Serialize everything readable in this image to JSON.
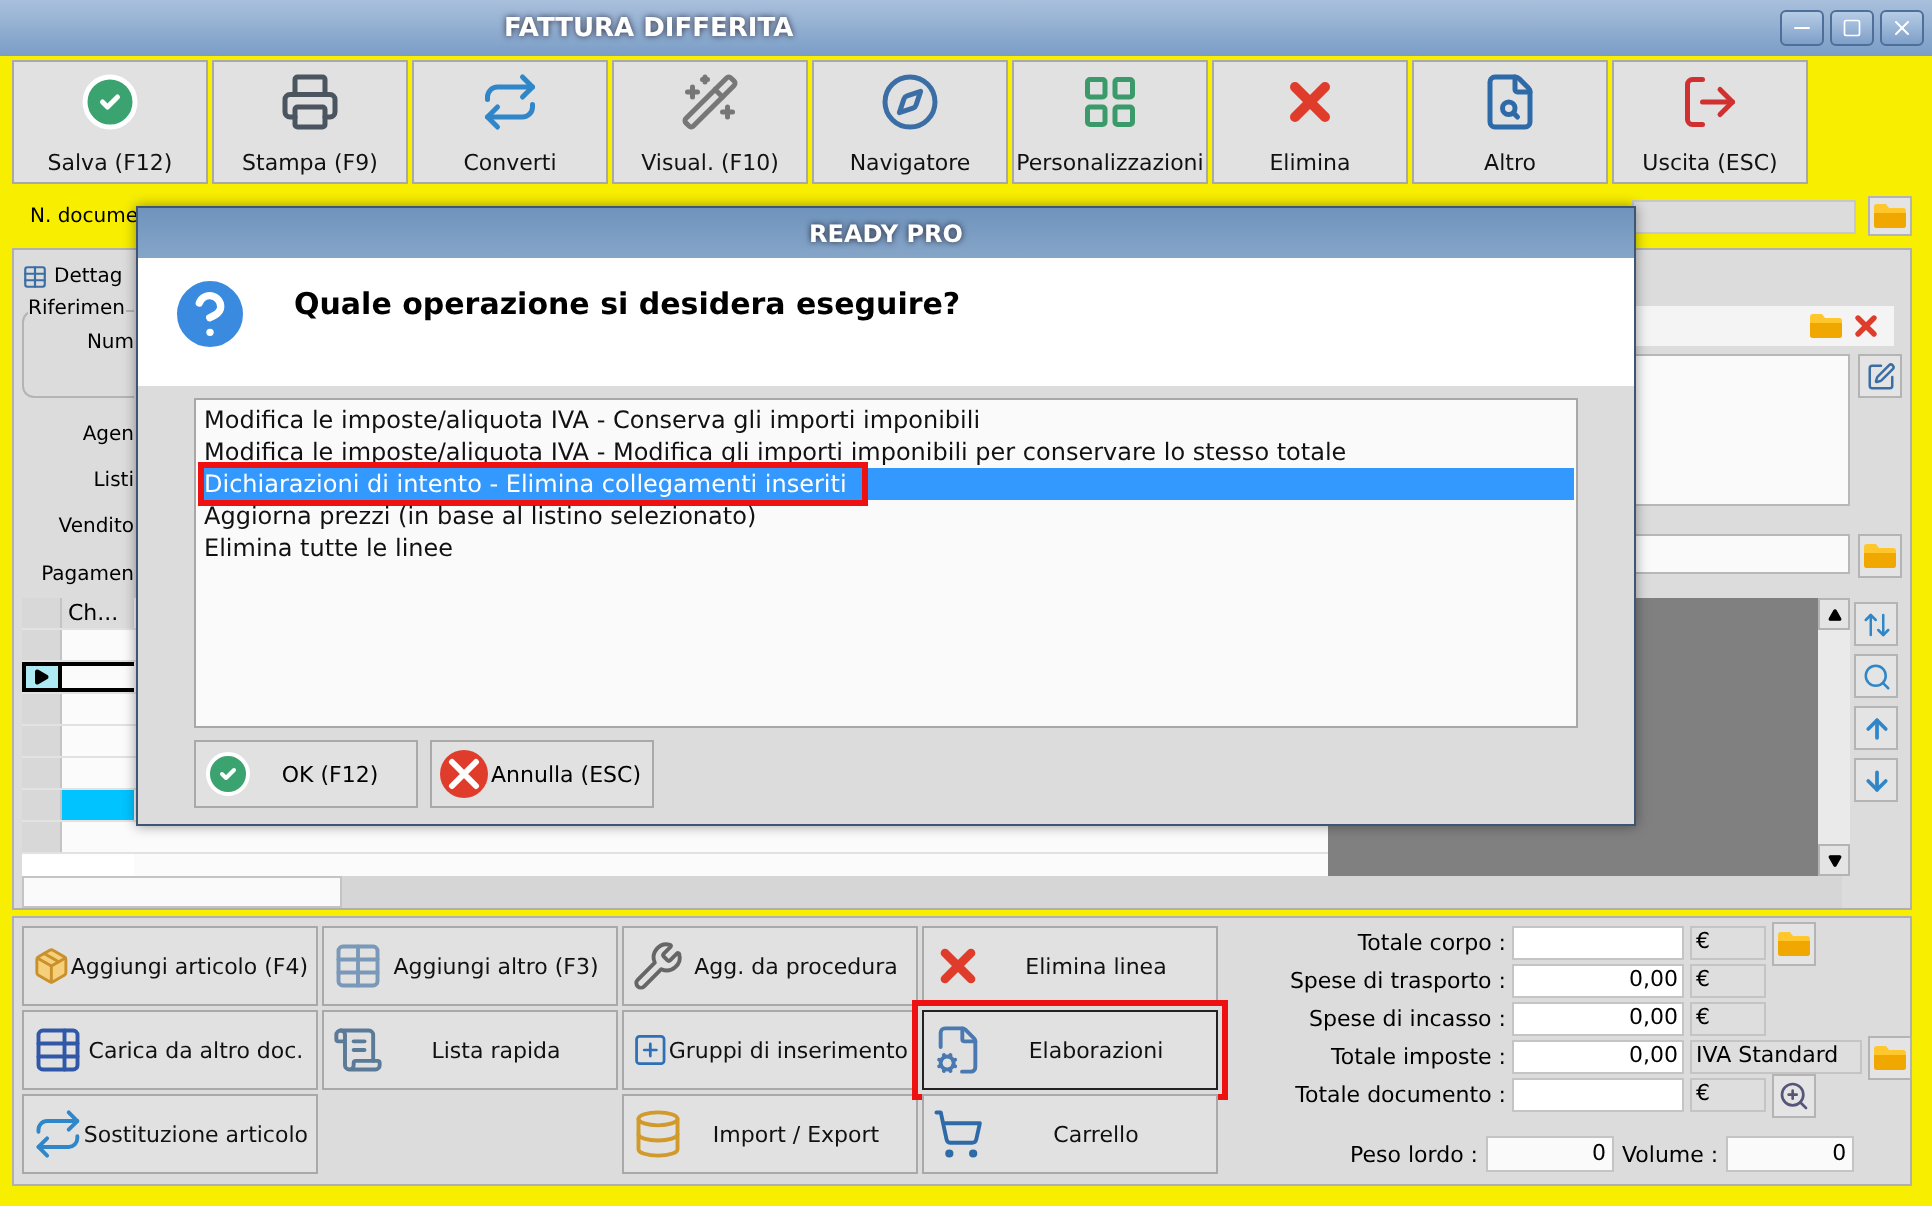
{
  "window": {
    "title": "FATTURA DIFFERITA"
  },
  "toolbar": [
    {
      "label": "Salva (F12)"
    },
    {
      "label": "Stampa (F9)"
    },
    {
      "label": "Converti"
    },
    {
      "label": "Visual. (F10)"
    },
    {
      "label": "Navigatore"
    },
    {
      "label": "Personalizzazioni"
    },
    {
      "label": "Elimina"
    },
    {
      "label": "Altro"
    },
    {
      "label": "Uscita (ESC)"
    }
  ],
  "document": {
    "label": "N. docume"
  },
  "tab": {
    "label": "Dettag"
  },
  "group": {
    "title": "Riferimen",
    "field": "Num"
  },
  "labels": [
    "Agen",
    "Listi",
    "Vendito",
    "Pagamen"
  ],
  "grid": {
    "column": "Ch...",
    "rows": [
      {
        "current": false,
        "selected": false
      },
      {
        "current": true,
        "selected": false
      },
      {
        "current": false,
        "selected": false
      },
      {
        "current": false,
        "selected": false
      },
      {
        "current": false,
        "selected": false
      },
      {
        "current": false,
        "selected": true
      },
      {
        "current": false,
        "selected": false
      }
    ]
  },
  "dialog": {
    "title": "READY PRO",
    "question": "Quale operazione si desidera eseguire?",
    "options": [
      {
        "label": "Modifica le imposte/aliquota IVA - Conserva gli importi imponibili",
        "selected": false,
        "highlighted": false
      },
      {
        "label": "Modifica le imposte/aliquota IVA - Modifica gli importi imponibili per conservare lo stesso totale",
        "selected": false,
        "highlighted": false
      },
      {
        "label": "Dichiarazioni di intento - Elimina collegamenti inseriti",
        "selected": true,
        "highlighted": true
      },
      {
        "label": "Aggiorna prezzi (in base al listino selezionato)",
        "selected": false,
        "highlighted": false
      },
      {
        "label": "Elimina tutte le linee",
        "selected": false,
        "highlighted": false
      }
    ],
    "buttons": [
      {
        "label": "OK (F12)",
        "kind": "ok"
      },
      {
        "label": "Annulla (ESC)",
        "kind": "cancel"
      }
    ]
  },
  "actions": [
    [
      {
        "label": "Aggiungi articolo (F4)",
        "highlighted": false
      },
      {
        "label": "Carica da altro doc.",
        "highlighted": false
      },
      {
        "label": "Sostituzione articolo",
        "highlighted": false
      }
    ],
    [
      {
        "label": "Aggiungi altro (F3)",
        "highlighted": false
      },
      {
        "label": "Lista rapida",
        "highlighted": false
      }
    ],
    [
      {
        "label": "Agg. da procedura",
        "highlighted": false
      },
      {
        "label": "Gruppi di inserimento",
        "highlighted": false
      },
      {
        "label": "Import / Export",
        "highlighted": false
      }
    ],
    [
      {
        "label": "Elimina linea",
        "highlighted": false
      },
      {
        "label": "Elaborazioni",
        "highlighted": true
      },
      {
        "label": "Carrello",
        "highlighted": false
      }
    ]
  ],
  "totals": [
    {
      "label": "Totale corpo :",
      "unit": "€"
    },
    {
      "label": "Spese di trasporto :",
      "value": "0,00",
      "unit": "€"
    },
    {
      "label": "Spese di incasso :",
      "value": "0,00",
      "unit": "€"
    },
    {
      "label": "Totale imposte :",
      "value": "0,00",
      "unit": "IVA Standard"
    },
    {
      "label": "Totale documento :",
      "unit": "€"
    }
  ],
  "weights": [
    {
      "label": "Peso lordo :",
      "value": "0"
    },
    {
      "label": "Volume :",
      "value": "0"
    }
  ]
}
